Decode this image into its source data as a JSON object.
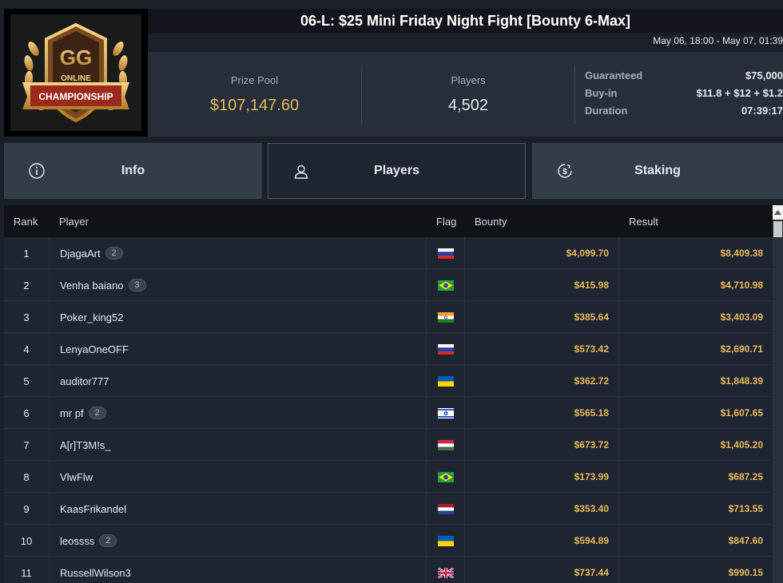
{
  "header": {
    "title": "06-L: $25 Mini Friday Night Fight [Bounty 6-Max]",
    "date_range": "May 06, 18:00 - May 07, 01:39",
    "logo_text_online": "ONLINE",
    "logo_text_champ": "CHAMPIONSHIP",
    "logo_text_gg": "GG"
  },
  "stats": {
    "prize_pool_label": "Prize Pool",
    "prize_pool_value": "$107,147.60",
    "players_label": "Players",
    "players_value": "4,502",
    "guaranteed_label": "Guaranteed",
    "guaranteed_value": "$75,000",
    "buyin_label": "Buy-in",
    "buyin_value": "$11.8 + $12 + $1.2",
    "duration_label": "Duration",
    "duration_value": "07:39:17"
  },
  "tabs": [
    {
      "label": "Info",
      "icon": "info-icon"
    },
    {
      "label": "Players",
      "icon": "user-icon",
      "active": true
    },
    {
      "label": "Staking",
      "icon": "dollar-coin-icon"
    }
  ],
  "table": {
    "headers": {
      "rank": "Rank",
      "player": "Player",
      "flag": "Flag",
      "bounty": "Bounty",
      "result": "Result"
    },
    "rows": [
      {
        "rank": "1",
        "player": "DjagaArt",
        "badge": "2",
        "flag": "ru",
        "bounty": "$4,099.70",
        "result": "$8,409.38"
      },
      {
        "rank": "2",
        "player": "Venha baiano",
        "badge": "3",
        "flag": "br",
        "bounty": "$415.98",
        "result": "$4,710.98"
      },
      {
        "rank": "3",
        "player": "Poker_king52",
        "badge": "",
        "flag": "in",
        "bounty": "$385.64",
        "result": "$3,403.09"
      },
      {
        "rank": "4",
        "player": "LenyaOneOFF",
        "badge": "",
        "flag": "ru",
        "bounty": "$573.42",
        "result": "$2,690.71"
      },
      {
        "rank": "5",
        "player": "auditor777",
        "badge": "",
        "flag": "ua",
        "bounty": "$362.72",
        "result": "$1,848.39"
      },
      {
        "rank": "6",
        "player": "mr pf",
        "badge": "2",
        "flag": "il",
        "bounty": "$565.18",
        "result": "$1,607.65"
      },
      {
        "rank": "7",
        "player": "A[r]T3M!s_",
        "badge": "",
        "flag": "hu",
        "bounty": "$673.72",
        "result": "$1,405.20"
      },
      {
        "rank": "8",
        "player": "VlwFlw",
        "badge": "",
        "flag": "br",
        "bounty": "$173.99",
        "result": "$687.25"
      },
      {
        "rank": "9",
        "player": "KaasFrikandel",
        "badge": "",
        "flag": "nl",
        "bounty": "$353.40",
        "result": "$713.55"
      },
      {
        "rank": "10",
        "player": "leossss",
        "badge": "2",
        "flag": "ua",
        "bounty": "$594.89",
        "result": "$847.60"
      },
      {
        "rank": "11",
        "player": "RussellWilson3",
        "badge": "",
        "flag": "gb",
        "bounty": "$737.44",
        "result": "$990.15"
      }
    ]
  },
  "colors": {
    "accent_gold": "#e8b85a",
    "panel": "#262e3a",
    "tab": "#333d4a",
    "table_bg": "#1e2530",
    "header_bg": "#0f1217"
  }
}
